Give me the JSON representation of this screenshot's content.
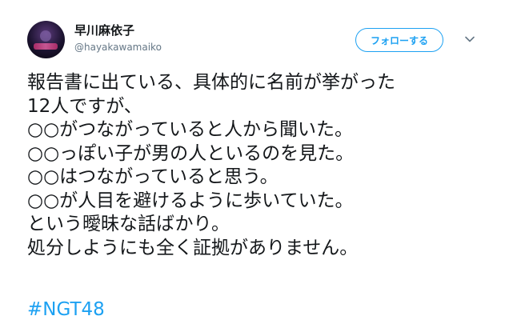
{
  "user": {
    "display_name": "早川麻依子",
    "handle": "@hayakawamaiko",
    "avatar": "avatar-photo"
  },
  "follow_button": {
    "label": "フォローする"
  },
  "menu": {
    "icon": "chevron-down-icon"
  },
  "tweet": {
    "lines": [
      "報告書に出ている、具体的に名前が挙がった",
      "12人ですが、",
      "○○がつながっていると人から聞いた。",
      "○○っぽい子が男の人といるのを見た。",
      "○○はつながっていると思う。",
      "○○が人目を避けるように歩いていた。",
      "という曖昧な話ばかり。",
      "処分しようにも全く証拠がありません。"
    ],
    "hashtag": "#NGT48"
  },
  "colors": {
    "accent": "#1da1f2",
    "text": "#14171a",
    "secondary": "#657786"
  }
}
